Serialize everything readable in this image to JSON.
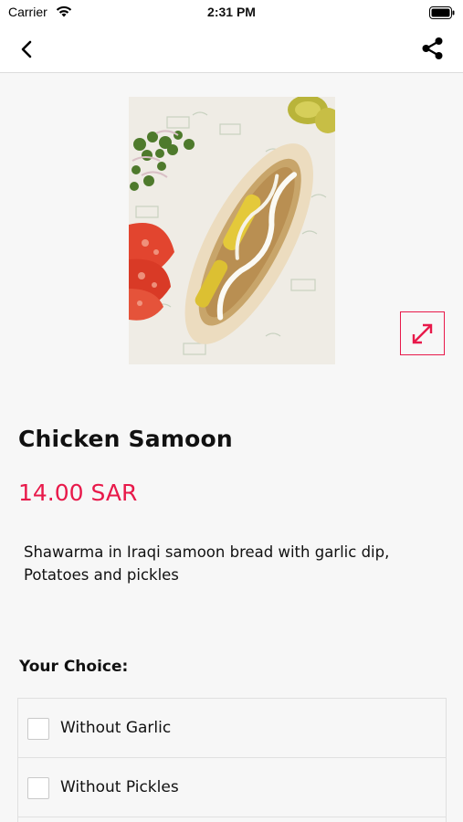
{
  "status_bar": {
    "carrier": "Carrier",
    "time": "2:31 PM"
  },
  "nav": {
    "back_icon": "chevron-left-icon",
    "share_icon": "share-icon"
  },
  "product": {
    "title": "Chicken Samoon",
    "price": "14.00 SAR",
    "description_line1": "Shawarma in Iraqi samoon bread with garlic dip,",
    "description_line2": "Potatoes and pickles"
  },
  "choices": {
    "heading": "Your Choice:",
    "options": [
      {
        "label": "Without Garlic",
        "checked": false
      },
      {
        "label": "Without Pickles",
        "checked": false
      }
    ]
  },
  "colors": {
    "accent": "#e8194a",
    "background": "#f7f7f7"
  }
}
